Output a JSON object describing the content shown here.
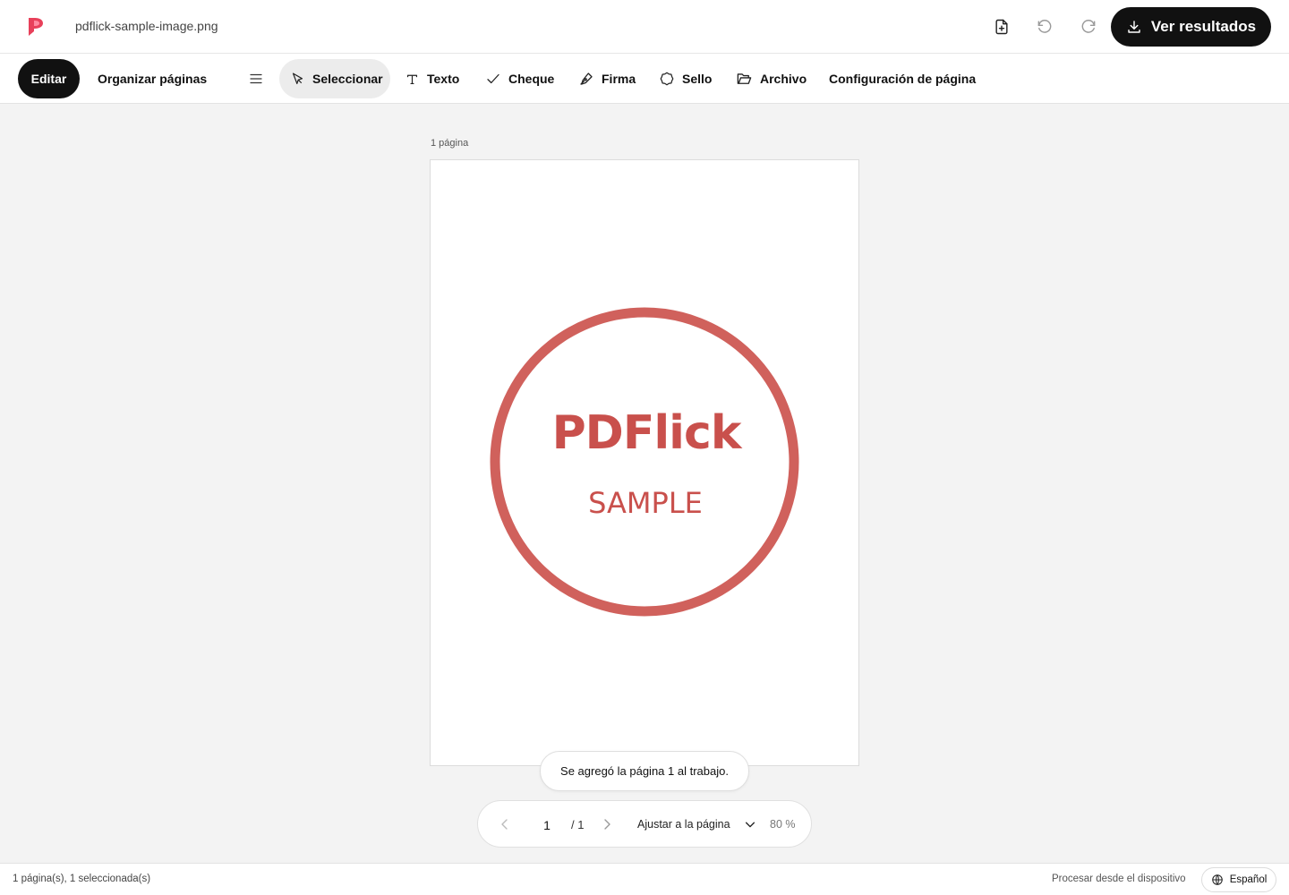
{
  "header": {
    "filename": "pdflick-sample-image.png",
    "results_label": "Ver resultados",
    "icons": [
      "add-file-icon",
      "undo-icon",
      "redo-icon",
      "download-icon"
    ]
  },
  "toolbar": {
    "edit": "Editar",
    "organize": "Organizar páginas",
    "select": "Seleccionar",
    "text": "Texto",
    "check": "Cheque",
    "sign": "Firma",
    "seal": "Sello",
    "file": "Archivo",
    "page_config": "Configuración de página",
    "active": "Seleccionar"
  },
  "canvas": {
    "page_count": "1 página",
    "stamp": {
      "title": "PDFlick",
      "subtitle": "SAMPLE",
      "color": "#d0615c"
    }
  },
  "toast": {
    "message": "Se agregó la página 1 al trabajo."
  },
  "pager": {
    "current_page": "1",
    "total": "/ 1",
    "fit_label": "Ajustar a la página",
    "zoom": "80 %"
  },
  "statusbar": {
    "selection": "1 página(s), 1 seleccionada(s)",
    "process": "Procesar desde el dispositivo",
    "language": "Español"
  },
  "colors": {
    "primary_dark": "#111111",
    "background": "#f3f3f3",
    "logo": "#e8405a"
  }
}
